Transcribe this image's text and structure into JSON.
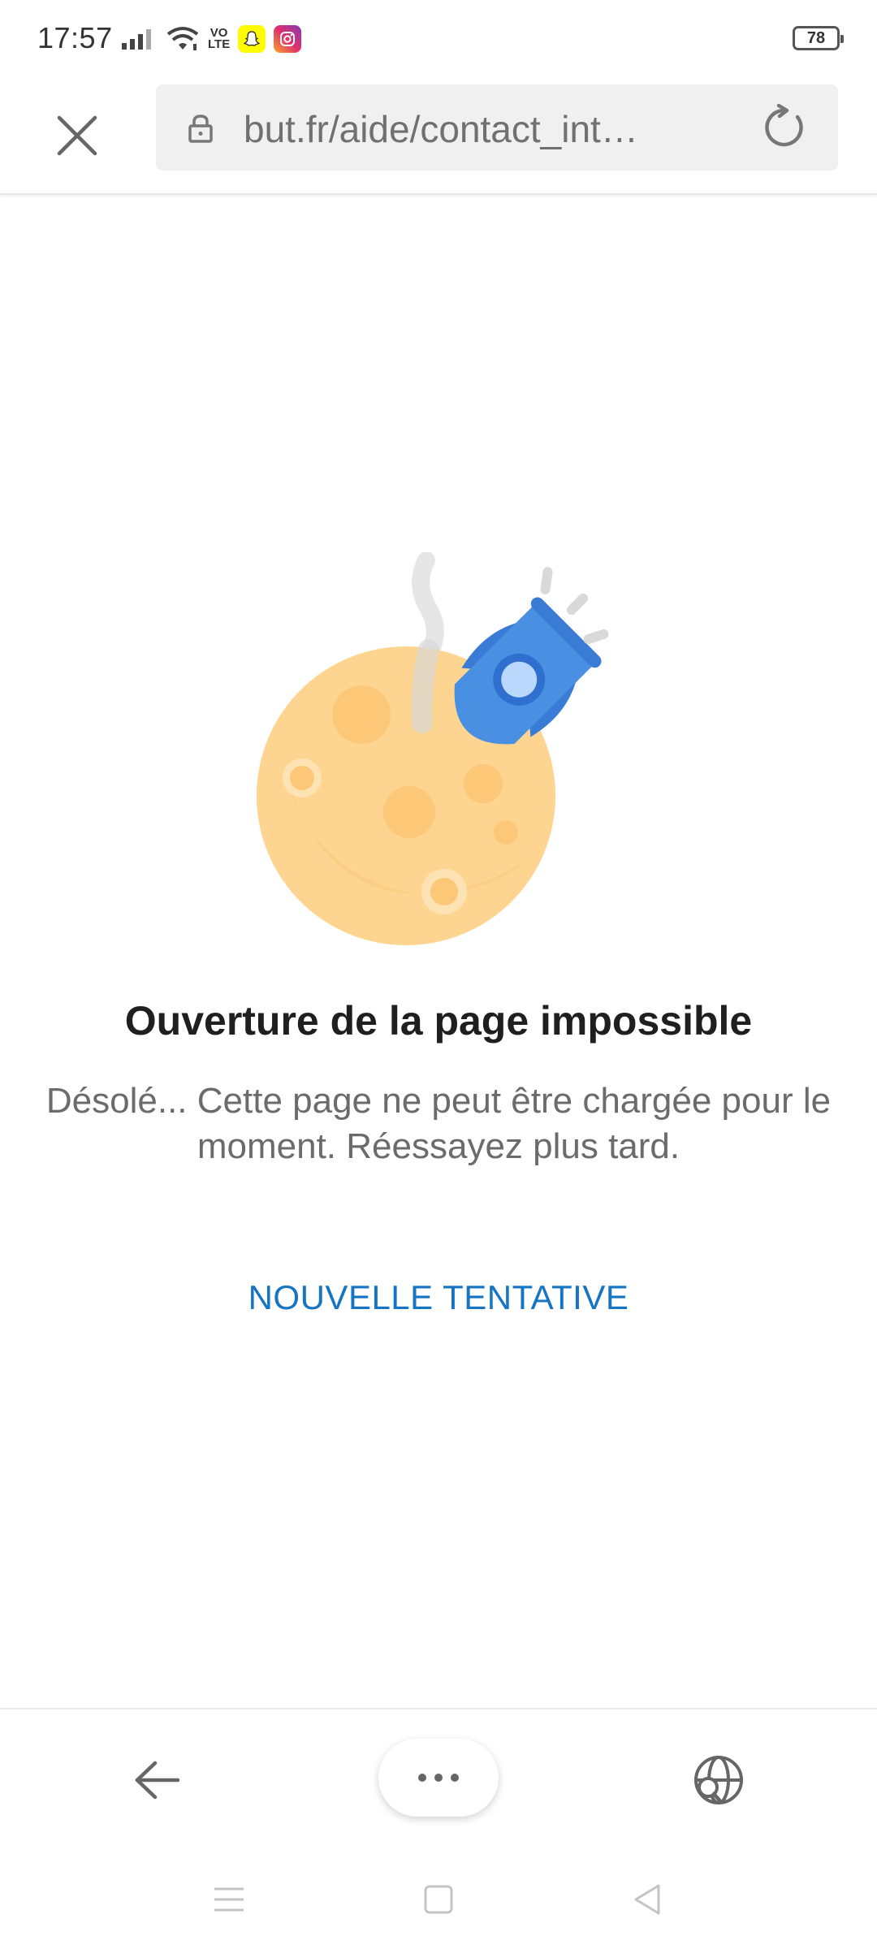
{
  "status_bar": {
    "time": "17:57",
    "network_label": "VO\nLTE",
    "battery": "78",
    "icons": [
      "signal-icon",
      "wifi-icon",
      "volte-icon",
      "snapchat-icon",
      "instagram-icon",
      "battery-icon"
    ]
  },
  "toolbar": {
    "url": "but.fr/aide/contact_inter...",
    "icons": [
      "close-icon",
      "lock-icon",
      "reload-icon"
    ]
  },
  "error": {
    "title": "Ouverture de la page impossible",
    "message": "Désolé... Cette page ne peut être chargée pour le moment. Réessayez plus tard.",
    "retry_label": "NOUVELLE TENTATIVE"
  },
  "bottom_bar": {
    "icons": [
      "back-arrow-icon",
      "more-icon",
      "globe-search-icon"
    ]
  },
  "nav_bar": {
    "icons": [
      "recents-icon",
      "home-icon",
      "back-icon"
    ]
  },
  "colors": {
    "accent": "#1574c4",
    "moon": "#fdd591",
    "rocket": "#4a90e2"
  }
}
